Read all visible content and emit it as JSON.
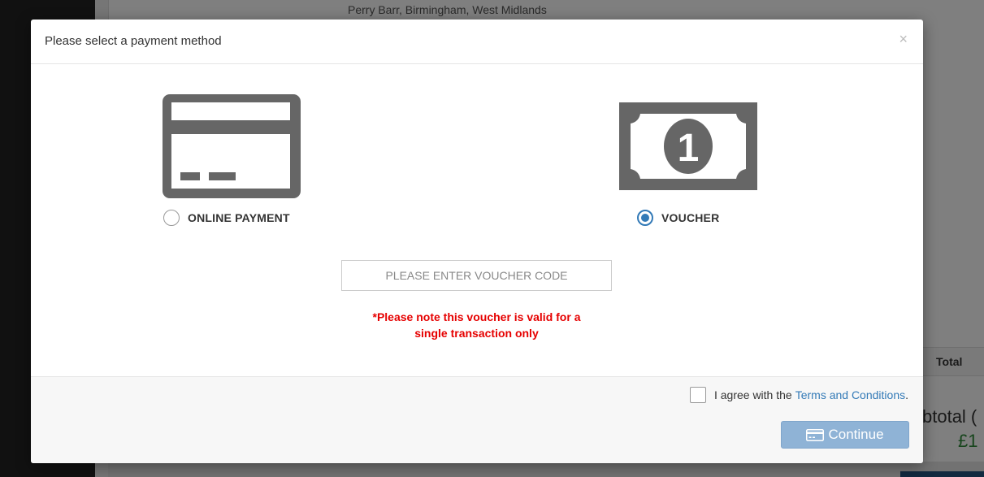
{
  "background": {
    "address": "Perry Barr, Birmingham, West Midlands",
    "table_header_total": "Total",
    "subtotal_label": "btotal (",
    "subtotal_amount": "£1"
  },
  "modal": {
    "title": "Please select a payment method",
    "close_symbol": "×",
    "options": [
      {
        "label": "ONLINE PAYMENT",
        "selected": false,
        "icon": "credit-card-icon"
      },
      {
        "label": "VOUCHER",
        "selected": true,
        "icon": "banknote-icon"
      }
    ],
    "voucher_input": {
      "placeholder": "PLEASE ENTER VOUCHER CODE",
      "value": ""
    },
    "voucher_note_line1": "*Please note this voucher is valid for a",
    "voucher_note_line2": "single transaction only",
    "terms": {
      "prefix": "I agree with the",
      "link_text": "Terms and Conditions",
      "suffix": ".",
      "checked": false
    },
    "continue_label": "Continue"
  },
  "colors": {
    "accent": "#337ab7",
    "warning": "#e60000",
    "icon_gray": "#666666"
  }
}
